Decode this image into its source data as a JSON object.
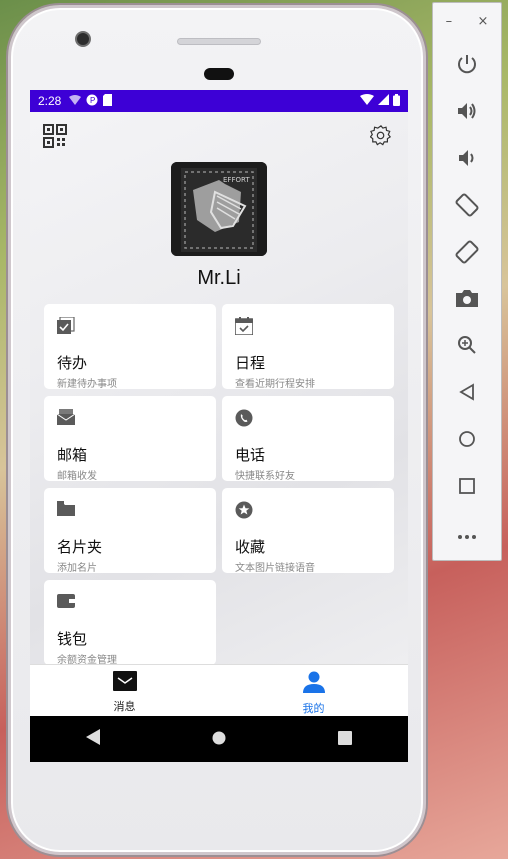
{
  "status_bar": {
    "time": "2:28"
  },
  "profile": {
    "name": "Mr.Li"
  },
  "cards": [
    {
      "title": "待办",
      "subtitle": "新建待办事项",
      "icon": "task-check-icon"
    },
    {
      "title": "日程",
      "subtitle": "查看近期行程安排",
      "icon": "calendar-icon"
    },
    {
      "title": "邮箱",
      "subtitle": "邮箱收发",
      "icon": "mail-icon"
    },
    {
      "title": "电话",
      "subtitle": "快捷联系好友",
      "icon": "phone-icon"
    },
    {
      "title": "名片夹",
      "subtitle": "添加名片",
      "icon": "folder-icon"
    },
    {
      "title": "收藏",
      "subtitle": "文本图片链接语音",
      "icon": "star-icon"
    },
    {
      "title": "钱包",
      "subtitle": "余额资金管理",
      "icon": "wallet-icon"
    }
  ],
  "bottom_nav": [
    {
      "label": "消息",
      "icon": "message-icon",
      "active": false
    },
    {
      "label": "我的",
      "icon": "person-icon",
      "active": true
    }
  ],
  "colors": {
    "status_bar": "#3d00d6",
    "active_tab": "#1a73e8",
    "inactive_tab": "#222222"
  },
  "emulator_toolbar": {
    "window_buttons": [
      "–",
      "×"
    ],
    "buttons": [
      "power-icon",
      "volume-up-icon",
      "volume-down-icon",
      "rotate-left-icon",
      "rotate-right-icon",
      "camera-icon",
      "zoom-icon",
      "back-icon",
      "home-icon",
      "overview-icon",
      "more-icon"
    ]
  }
}
